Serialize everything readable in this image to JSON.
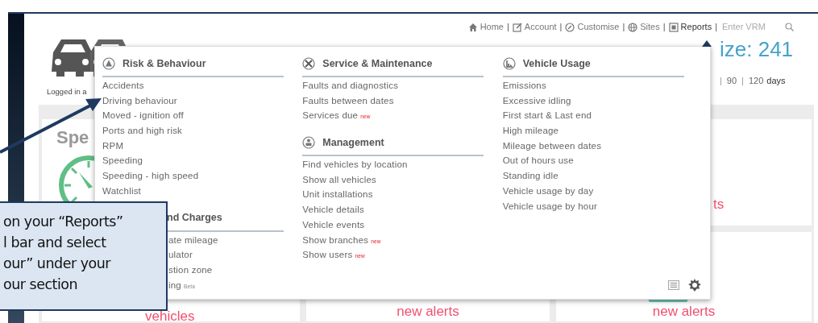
{
  "top_nav": {
    "items": [
      {
        "kind": "link",
        "label": "Home",
        "selected": false
      },
      {
        "kind": "separator",
        "label": "|"
      },
      {
        "kind": "link",
        "label": "Account",
        "selected": false
      },
      {
        "kind": "separator",
        "label": "|"
      },
      {
        "kind": "link",
        "label": "Customise",
        "selected": false
      },
      {
        "kind": "separator",
        "label": "|"
      },
      {
        "kind": "link",
        "label": "Sites",
        "selected": false
      },
      {
        "kind": "separator",
        "label": "|"
      },
      {
        "kind": "link",
        "label": "Reports",
        "selected": true
      },
      {
        "kind": "separator",
        "label": "|"
      }
    ],
    "search": {
      "placeholder": "Enter VRM"
    }
  },
  "header": {
    "logged_in": "Logged in a",
    "fleet_size": "ize: 241",
    "periods": [
      {
        "kind": "separator",
        "label": "|"
      },
      {
        "kind": "link",
        "label": "90"
      },
      {
        "kind": "separator",
        "label": "|"
      },
      {
        "kind": "link",
        "label": "120"
      },
      {
        "kind": "unit",
        "label": "days"
      }
    ]
  },
  "cards": [
    {
      "kind": "tall",
      "title": "Spe",
      "caption": "vehicles"
    },
    {
      "kind": "bottom",
      "caption": "new alerts"
    },
    {
      "kind": "top",
      "caption": "ts"
    },
    {
      "kind": "bottom",
      "caption": "new alerts"
    }
  ],
  "menu": {
    "columns": [
      [
        {
          "kind": "full",
          "heading": "Risk & Behaviour",
          "items": [
            {
              "label": "Accidents"
            },
            {
              "label": "Driving behaviour"
            },
            {
              "label": "Moved - ignition off"
            },
            {
              "label": "Ports and high risk"
            },
            {
              "label": "RPM"
            },
            {
              "label": "Speeding"
            },
            {
              "label": "Speeding - high speed"
            },
            {
              "label": "Watchlist"
            }
          ]
        },
        {
          "kind": "covered",
          "heading": "nd Charges",
          "items": [
            {
              "label": "ate mileage"
            },
            {
              "label": "ulator"
            },
            {
              "label": "stion zone"
            },
            {
              "label": "ing",
              "badge": {
                "kind": "beta",
                "text": "Beta"
              }
            }
          ]
        }
      ],
      [
        {
          "kind": "full",
          "heading": "Service & Maintenance",
          "items": [
            {
              "label": "Faults and diagnostics"
            },
            {
              "label": "Faults between dates"
            },
            {
              "label": "Services due",
              "badge": {
                "kind": "new",
                "text": "new"
              }
            }
          ]
        },
        {
          "kind": "full",
          "heading": "Management",
          "items": [
            {
              "label": "Find vehicles by location"
            },
            {
              "label": "Show all vehicles"
            },
            {
              "label": "Unit installations"
            },
            {
              "label": "Vehicle details"
            },
            {
              "label": "Vehicle events"
            },
            {
              "label": "Show branches",
              "badge": {
                "kind": "new",
                "text": "new"
              }
            },
            {
              "label": "Show users",
              "badge": {
                "kind": "new",
                "text": "new"
              }
            }
          ]
        }
      ],
      [
        {
          "kind": "full",
          "heading": "Vehicle Usage",
          "items": [
            {
              "label": "Emissions"
            },
            {
              "label": "Excessive idling"
            },
            {
              "label": "First start & Last end"
            },
            {
              "label": "High mileage"
            },
            {
              "label": "Mileage between dates"
            },
            {
              "label": "Out of hours use"
            },
            {
              "label": "Standing idle"
            },
            {
              "label": "Vehicle usage by day"
            },
            {
              "label": "Vehicle usage by hour"
            }
          ]
        }
      ]
    ]
  },
  "callout": {
    "lines": [
      "on your “Reports”",
      "l bar and select",
      "our” under your",
      "our section"
    ]
  }
}
